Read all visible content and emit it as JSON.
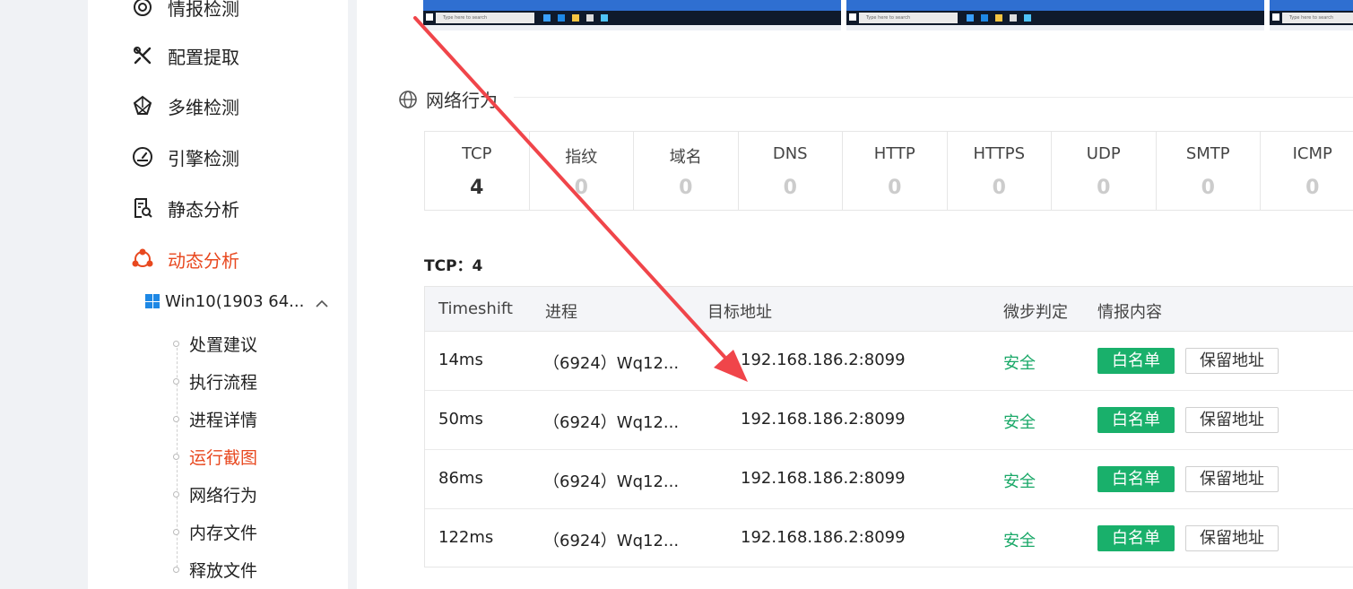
{
  "sidebar": {
    "nav": [
      {
        "label": "情报检测",
        "icon": "radar-icon"
      },
      {
        "label": "配置提取",
        "icon": "tools-icon"
      },
      {
        "label": "多维检测",
        "icon": "network-star-icon"
      },
      {
        "label": "引擎检测",
        "icon": "gauge-icon"
      },
      {
        "label": "静态分析",
        "icon": "document-search-icon"
      },
      {
        "label": "动态分析",
        "icon": "nodes-icon",
        "active": true
      }
    ],
    "env_label": "Win10(1903 64...",
    "sub_items": [
      {
        "label": "处置建议"
      },
      {
        "label": "执行流程"
      },
      {
        "label": "进程详情"
      },
      {
        "label": "运行截图",
        "active": true
      },
      {
        "label": "网络行为"
      },
      {
        "label": "内存文件"
      },
      {
        "label": "释放文件"
      }
    ]
  },
  "screenshots": {
    "search_placeholder": "Type here to search"
  },
  "network": {
    "section_title": "网络行为",
    "stats": [
      {
        "key": "TCP",
        "value": "4"
      },
      {
        "key": "指纹",
        "value": "0"
      },
      {
        "key": "域名",
        "value": "0"
      },
      {
        "key": "DNS",
        "value": "0"
      },
      {
        "key": "HTTP",
        "value": "0"
      },
      {
        "key": "HTTPS",
        "value": "0"
      },
      {
        "key": "UDP",
        "value": "0"
      },
      {
        "key": "SMTP",
        "value": "0"
      },
      {
        "key": "ICMP",
        "value": "0"
      }
    ],
    "tcp_title": "TCP：4",
    "columns": [
      "Timeshift",
      "进程",
      "目标地址",
      "微步判定",
      "情报内容"
    ],
    "rows": [
      {
        "timeshift": "14ms",
        "process": "（6924）Wq12...",
        "target": "192.168.186.2:8099",
        "verdict": "安全",
        "whitelist": "白名单",
        "keep": "保留地址"
      },
      {
        "timeshift": "50ms",
        "process": "（6924）Wq12...",
        "target": "192.168.186.2:8099",
        "verdict": "安全",
        "whitelist": "白名单",
        "keep": "保留地址"
      },
      {
        "timeshift": "86ms",
        "process": "（6924）Wq12...",
        "target": "192.168.186.2:8099",
        "verdict": "安全",
        "whitelist": "白名单",
        "keep": "保留地址"
      },
      {
        "timeshift": "122ms",
        "process": "（6924）Wq12...",
        "target": "192.168.186.2:8099",
        "verdict": "安全",
        "whitelist": "白名单",
        "keep": "保留地址"
      }
    ]
  },
  "colors": {
    "accent_active": "#e8481f",
    "safe_green": "#1aa868",
    "whitelist_green": "#19b06b",
    "annotation_red": "#f0454a"
  }
}
